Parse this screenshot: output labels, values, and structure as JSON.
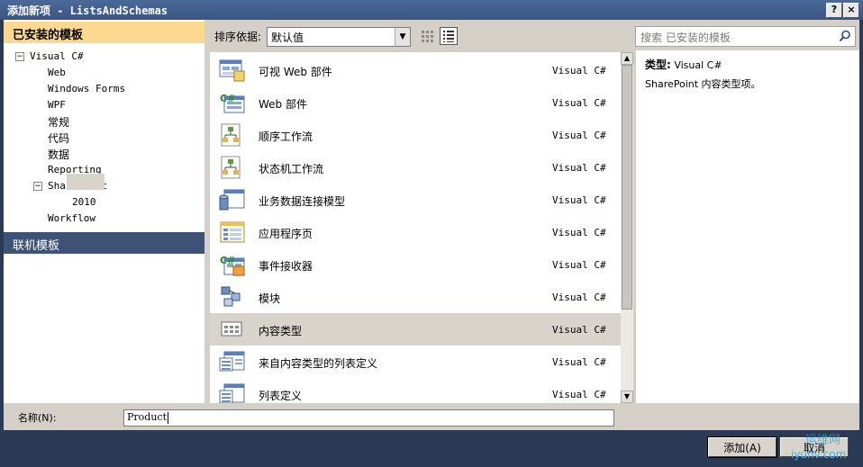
{
  "window": {
    "title": "添加新项 - ListsAndSchemas",
    "help_btn": "?",
    "close_btn": "×"
  },
  "sidebar": {
    "header": "已安装的模板",
    "tree": [
      {
        "label": "Visual C#",
        "expanded": true
      },
      {
        "label": "Web"
      },
      {
        "label": "Windows Forms"
      },
      {
        "label": "WPF"
      },
      {
        "label": "常规"
      },
      {
        "label": "代码"
      },
      {
        "label": "数据"
      },
      {
        "label": "Reporting"
      },
      {
        "label": "SharePoint",
        "expanded": true
      },
      {
        "label": "2010",
        "selected": true
      },
      {
        "label": "Workflow"
      }
    ],
    "online": "联机模板",
    "expander_symbol": "−"
  },
  "toolbar": {
    "sort_label": "排序依据:",
    "sort_value": "默认值"
  },
  "search": {
    "placeholder": "搜索 已安装的模板"
  },
  "templates": [
    {
      "name": "可视 Web 部件",
      "lang": "Visual C#",
      "icon": "visual-web-part-icon"
    },
    {
      "name": "Web 部件",
      "lang": "Visual C#",
      "icon": "csharp-web-part-icon"
    },
    {
      "name": "顺序工作流",
      "lang": "Visual C#",
      "icon": "workflow-icon"
    },
    {
      "name": "状态机工作流",
      "lang": "Visual C#",
      "icon": "workflow-icon"
    },
    {
      "name": "业务数据连接模型",
      "lang": "Visual C#",
      "icon": "bdc-model-icon"
    },
    {
      "name": "应用程序页",
      "lang": "Visual C#",
      "icon": "application-page-icon"
    },
    {
      "name": "事件接收器",
      "lang": "Visual C#",
      "icon": "event-receiver-icon"
    },
    {
      "name": "模块",
      "lang": "Visual C#",
      "icon": "module-icon"
    },
    {
      "name": "内容类型",
      "lang": "Visual C#",
      "icon": "content-type-icon",
      "selected": true
    },
    {
      "name": "来自内容类型的列表定义",
      "lang": "Visual C#",
      "icon": "list-definition-icon"
    },
    {
      "name": "列表定义",
      "lang": "Visual C#",
      "icon": "list-definition-icon"
    }
  ],
  "details": {
    "type_label": "类型:",
    "type_value": "Visual C#",
    "description": "SharePoint 内容类型项。"
  },
  "name_field": {
    "label": "名称(N):",
    "value": "Product"
  },
  "buttons": {
    "add": "添加(A)",
    "cancel": "取消"
  },
  "watermark": {
    "line1": "运维网",
    "line2": "iyunv.com"
  }
}
